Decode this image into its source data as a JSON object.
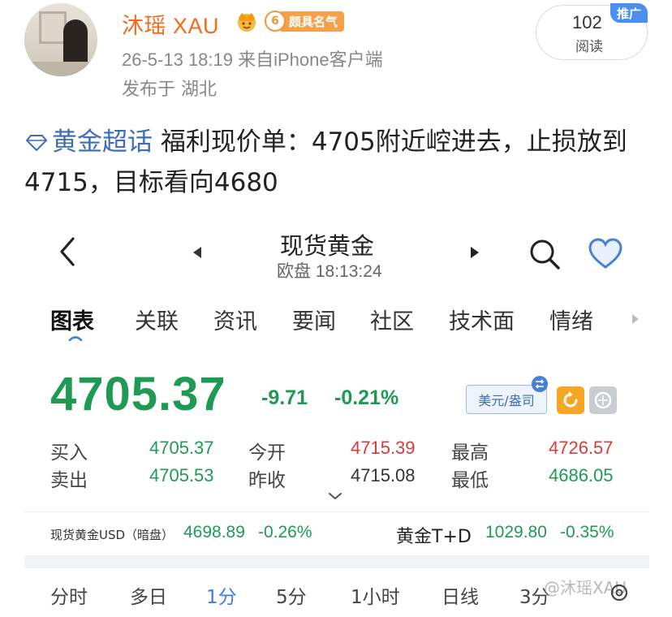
{
  "post": {
    "user_name": "沐瑶 XAU",
    "badge_level": "6",
    "badge_text": "颇具名气",
    "meta": "26-5-13 18:19  来自iPhone客户端",
    "location": "发布于 湖北",
    "read_count": "102",
    "read_label": "阅读",
    "promo_tag": "推广",
    "topic": "黄金超话",
    "body": "  福利现价单：4705附近崆进去，止损放到4715，目标看向4680"
  },
  "app": {
    "title": "现货黄金",
    "subtitle": "欧盘 18:13:24",
    "tabs": [
      "图表",
      "关联",
      "资讯",
      "要闻",
      "社区",
      "技术面",
      "情绪"
    ],
    "price": "4705.37",
    "change_abs": "-9.71",
    "change_pct": "-0.21%",
    "currency_btn": "美元/盎司",
    "quotes": {
      "buy_label": "买入",
      "buy": "4705.37",
      "open_label": "今开",
      "open": "4715.39",
      "high_label": "最高",
      "high": "4726.57",
      "sell_label": "卖出",
      "sell": "4705.53",
      "prev_label": "昨收",
      "prev": "4715.08",
      "low_label": "最低",
      "low": "4686.05"
    },
    "ticker_left": {
      "label": "现货黄金USD（暗盘）",
      "price": "4698.89",
      "change": "-0.26%"
    },
    "ticker_right": {
      "label": "黄金T+D",
      "price": "1029.80",
      "change": "-0.35%"
    },
    "periods": [
      "分时",
      "多日",
      "1分",
      "5分",
      "1小时",
      "日线",
      "3分"
    ],
    "watermark": "@沐瑶XAU"
  },
  "colors": {
    "accent_orange": "#f26b1d",
    "down_green": "#1f9a55",
    "up_red": "#d93a3a",
    "link_blue": "#3d6db5"
  }
}
